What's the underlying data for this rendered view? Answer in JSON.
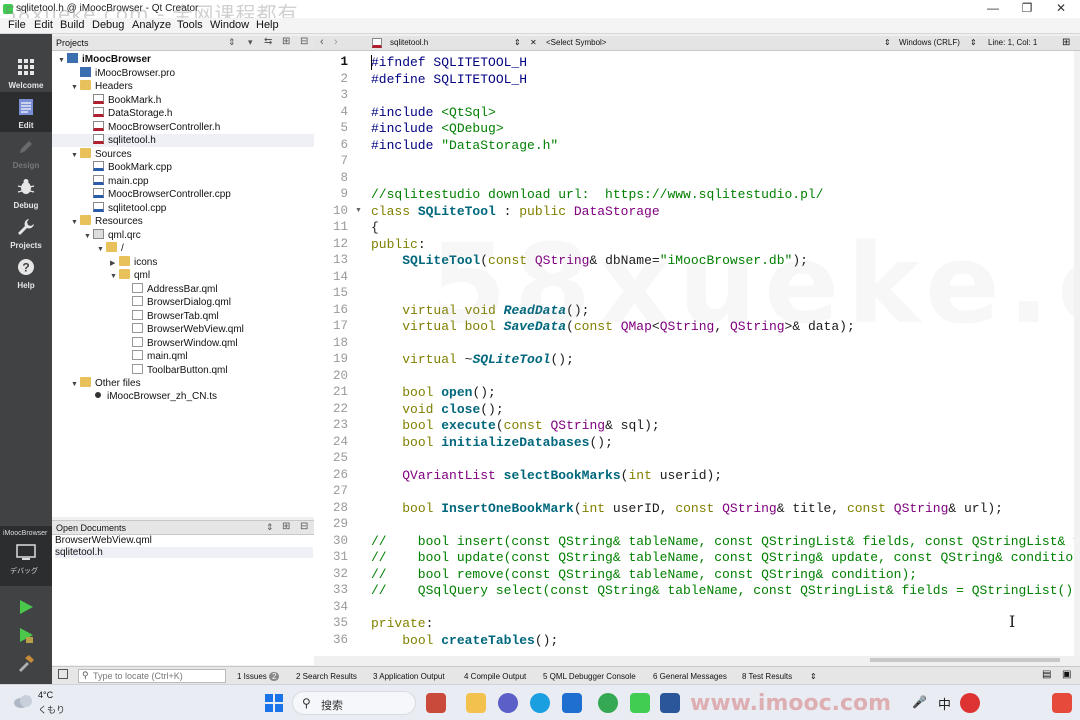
{
  "window": {
    "title": "sqlitetool.h @ iMoocBrowser - Qt Creator",
    "watermark": "58xueke.com - 全网课程都有"
  },
  "menu": [
    "File",
    "Edit",
    "Build",
    "Debug",
    "Analyze",
    "Tools",
    "Window",
    "Help"
  ],
  "modes": [
    {
      "label": "Welcome",
      "icon": "grid-icon"
    },
    {
      "label": "Edit",
      "icon": "document-edit-icon"
    },
    {
      "label": "Design",
      "icon": "pencil-icon"
    },
    {
      "label": "Debug",
      "icon": "bug-icon"
    },
    {
      "label": "Projects",
      "icon": "wrench-icon"
    },
    {
      "label": "Help",
      "icon": "help-icon"
    }
  ],
  "kit": {
    "project": "iMoocBrowser",
    "config": "デバッグ"
  },
  "projects_pane": {
    "title": "Projects",
    "tree": [
      {
        "label": "iMoocBrowser",
        "depth": 0,
        "type": "project",
        "expanded": true
      },
      {
        "label": "iMoocBrowser.pro",
        "depth": 1,
        "type": "pro"
      },
      {
        "label": "Headers",
        "depth": 1,
        "type": "folder",
        "expanded": true
      },
      {
        "label": "BookMark.h",
        "depth": 2,
        "type": "h"
      },
      {
        "label": "DataStorage.h",
        "depth": 2,
        "type": "h"
      },
      {
        "label": "MoocBrowserController.h",
        "depth": 2,
        "type": "h"
      },
      {
        "label": "sqlitetool.h",
        "depth": 2,
        "type": "h",
        "selected": true
      },
      {
        "label": "Sources",
        "depth": 1,
        "type": "folder",
        "expanded": true
      },
      {
        "label": "BookMark.cpp",
        "depth": 2,
        "type": "cpp"
      },
      {
        "label": "main.cpp",
        "depth": 2,
        "type": "cpp"
      },
      {
        "label": "MoocBrowserController.cpp",
        "depth": 2,
        "type": "cpp"
      },
      {
        "label": "sqlitetool.cpp",
        "depth": 2,
        "type": "cpp"
      },
      {
        "label": "Resources",
        "depth": 1,
        "type": "folder",
        "expanded": true
      },
      {
        "label": "qml.qrc",
        "depth": 2,
        "type": "qrc",
        "expanded": true
      },
      {
        "label": "/",
        "depth": 3,
        "type": "folder",
        "expanded": true
      },
      {
        "label": "icons",
        "depth": 4,
        "type": "folder",
        "expanded": false
      },
      {
        "label": "qml",
        "depth": 4,
        "type": "folder",
        "expanded": true
      },
      {
        "label": "AddressBar.qml",
        "depth": 5,
        "type": "qml"
      },
      {
        "label": "BrowserDialog.qml",
        "depth": 5,
        "type": "qml"
      },
      {
        "label": "BrowserTab.qml",
        "depth": 5,
        "type": "qml"
      },
      {
        "label": "BrowserWebView.qml",
        "depth": 5,
        "type": "qml"
      },
      {
        "label": "BrowserWindow.qml",
        "depth": 5,
        "type": "qml"
      },
      {
        "label": "main.qml",
        "depth": 5,
        "type": "qml"
      },
      {
        "label": "ToolbarButton.qml",
        "depth": 5,
        "type": "qml"
      },
      {
        "label": "Other files",
        "depth": 1,
        "type": "folder",
        "expanded": true
      },
      {
        "label": "iMoocBrowser_zh_CN.ts",
        "depth": 2,
        "type": "ts"
      }
    ]
  },
  "open_documents": {
    "title": "Open Documents",
    "items": [
      "BrowserWebView.qml",
      "sqlitetool.h"
    ]
  },
  "editor_toolbar": {
    "file": "sqlitetool.h",
    "symbol": "<Select Symbol>",
    "encoding": "Windows (CRLF)",
    "position": "Line: 1, Col: 1"
  },
  "editor": {
    "lines": [
      {
        "n": 1,
        "parts": [
          [
            "pp",
            "#ifndef SQLITETOOL_H"
          ]
        ]
      },
      {
        "n": 2,
        "parts": [
          [
            "pp",
            "#define SQLITETOOL_H"
          ]
        ]
      },
      {
        "n": 3,
        "parts": []
      },
      {
        "n": 4,
        "parts": [
          [
            "pp",
            "#include "
          ],
          [
            "str",
            "<QtSql>"
          ]
        ]
      },
      {
        "n": 5,
        "parts": [
          [
            "pp",
            "#include "
          ],
          [
            "str",
            "<QDebug>"
          ]
        ]
      },
      {
        "n": 6,
        "parts": [
          [
            "pp",
            "#include "
          ],
          [
            "str",
            "\"DataStorage.h\""
          ]
        ]
      },
      {
        "n": 7,
        "parts": []
      },
      {
        "n": 8,
        "parts": []
      },
      {
        "n": 9,
        "parts": [
          [
            "cm",
            "//sqlitestudio download url:  https://www.sqlitestudio.pl/"
          ]
        ]
      },
      {
        "n": 10,
        "fold": true,
        "parts": [
          [
            "kw",
            "class "
          ],
          [
            "fn",
            "SQLiteTool"
          ],
          [
            "",
            " : "
          ],
          [
            "kw",
            "public "
          ],
          [
            "ty",
            "DataStorage"
          ]
        ]
      },
      {
        "n": 11,
        "parts": [
          [
            "",
            "{"
          ]
        ]
      },
      {
        "n": 12,
        "parts": [
          [
            "kw",
            "public"
          ],
          [
            "",
            ":"
          ]
        ]
      },
      {
        "n": 13,
        "parts": [
          [
            "",
            "    "
          ],
          [
            "fn",
            "SQLiteTool"
          ],
          [
            "",
            "("
          ],
          [
            "kw",
            "const "
          ],
          [
            "ty",
            "QString"
          ],
          [
            "",
            "& dbName="
          ],
          [
            "str",
            "\"iMoocBrowser.db\""
          ],
          [
            "",
            ");"
          ]
        ]
      },
      {
        "n": 14,
        "parts": []
      },
      {
        "n": 15,
        "parts": []
      },
      {
        "n": 16,
        "parts": [
          [
            "",
            "    "
          ],
          [
            "kw",
            "virtual void "
          ],
          [
            "fni",
            "ReadData"
          ],
          [
            "",
            "();"
          ]
        ]
      },
      {
        "n": 17,
        "parts": [
          [
            "",
            "    "
          ],
          [
            "kw",
            "virtual bool "
          ],
          [
            "fni",
            "SaveData"
          ],
          [
            "",
            "("
          ],
          [
            "kw",
            "const "
          ],
          [
            "ty",
            "QMap"
          ],
          [
            "",
            "<"
          ],
          [
            "ty",
            "QString"
          ],
          [
            "",
            ", "
          ],
          [
            "ty",
            "QString"
          ],
          [
            "",
            ">& data);"
          ]
        ]
      },
      {
        "n": 18,
        "parts": []
      },
      {
        "n": 19,
        "parts": [
          [
            "",
            "    "
          ],
          [
            "kw",
            "virtual "
          ],
          [
            "",
            "~"
          ],
          [
            "fni",
            "SQLiteTool"
          ],
          [
            "",
            "();"
          ]
        ]
      },
      {
        "n": 20,
        "parts": []
      },
      {
        "n": 21,
        "parts": [
          [
            "",
            "    "
          ],
          [
            "kw",
            "bool "
          ],
          [
            "fn",
            "open"
          ],
          [
            "",
            "();"
          ]
        ]
      },
      {
        "n": 22,
        "parts": [
          [
            "",
            "    "
          ],
          [
            "kw",
            "void "
          ],
          [
            "fn",
            "close"
          ],
          [
            "",
            "();"
          ]
        ]
      },
      {
        "n": 23,
        "parts": [
          [
            "",
            "    "
          ],
          [
            "kw",
            "bool "
          ],
          [
            "fn",
            "execute"
          ],
          [
            "",
            "("
          ],
          [
            "kw",
            "const "
          ],
          [
            "ty",
            "QString"
          ],
          [
            "",
            "& sql);"
          ]
        ]
      },
      {
        "n": 24,
        "parts": [
          [
            "",
            "    "
          ],
          [
            "kw",
            "bool "
          ],
          [
            "fn",
            "initializeDatabases"
          ],
          [
            "",
            "();"
          ]
        ]
      },
      {
        "n": 25,
        "parts": []
      },
      {
        "n": 26,
        "parts": [
          [
            "",
            "    "
          ],
          [
            "ty",
            "QVariantList "
          ],
          [
            "fn",
            "selectBookMarks"
          ],
          [
            "",
            "("
          ],
          [
            "kw",
            "int "
          ],
          [
            "",
            "userid);"
          ]
        ]
      },
      {
        "n": 27,
        "parts": []
      },
      {
        "n": 28,
        "parts": [
          [
            "",
            "    "
          ],
          [
            "kw",
            "bool "
          ],
          [
            "fn",
            "InsertOneBookMark"
          ],
          [
            "",
            "("
          ],
          [
            "kw",
            "int "
          ],
          [
            "",
            "userID, "
          ],
          [
            "kw",
            "const "
          ],
          [
            "ty",
            "QString"
          ],
          [
            "",
            "& title, "
          ],
          [
            "kw",
            "const "
          ],
          [
            "ty",
            "QString"
          ],
          [
            "",
            "& url);"
          ]
        ]
      },
      {
        "n": 29,
        "parts": []
      },
      {
        "n": 30,
        "parts": [
          [
            "cm",
            "//    bool insert(const QString& tableName, const QStringList& fields, const QStringList& va"
          ]
        ]
      },
      {
        "n": 31,
        "parts": [
          [
            "cm",
            "//    bool update(const QString& tableName, const QString& update, const QString& condition"
          ]
        ]
      },
      {
        "n": 32,
        "parts": [
          [
            "cm",
            "//    bool remove(const QString& tableName, const QString& condition);"
          ]
        ]
      },
      {
        "n": 33,
        "parts": [
          [
            "cm",
            "//    QSqlQuery select(const QString& tableName, const QStringList& fields = QStringList(),"
          ]
        ]
      },
      {
        "n": 34,
        "parts": []
      },
      {
        "n": 35,
        "parts": [
          [
            "kw",
            "private"
          ],
          [
            "",
            ":"
          ]
        ]
      },
      {
        "n": 36,
        "parts": [
          [
            "",
            "    "
          ],
          [
            "kw",
            "bool "
          ],
          [
            "fn",
            "createTables"
          ],
          [
            "",
            "();"
          ]
        ]
      }
    ]
  },
  "output_bar": {
    "locator_placeholder": "Type to locate (Ctrl+K)",
    "tabs": [
      {
        "label": "1  Issues",
        "badge": "2"
      },
      {
        "label": "2  Search Results"
      },
      {
        "label": "3  Application Output"
      },
      {
        "label": "4  Compile Output"
      },
      {
        "label": "5  QML Debugger Console"
      },
      {
        "label": "6  General Messages"
      },
      {
        "label": "8  Test Results"
      }
    ]
  },
  "taskbar": {
    "weather_temp": "4°C",
    "weather_desc": "くもり",
    "search_label": "搜索",
    "ime": "中",
    "watermark": "www.imooc.com"
  },
  "colors": {
    "accent": "#41cd52",
    "modebar": "#404244",
    "keyword": "#808000",
    "type": "#800080",
    "string": "#008000"
  }
}
